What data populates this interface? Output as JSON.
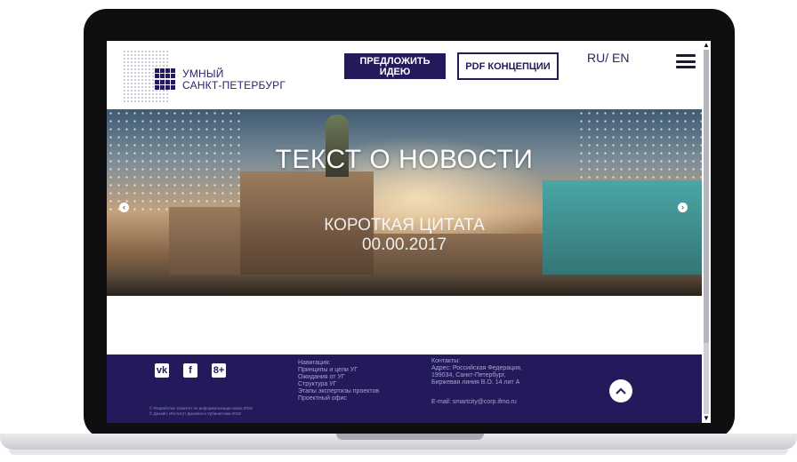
{
  "header": {
    "logo_line1": "УМНЫЙ",
    "logo_line2": "САНКТ-ПЕТЕРБУРГ",
    "idea_button_line1": "ПРЕДЛОЖИТЬ",
    "idea_button_line2": "ИДЕЮ",
    "pdf_button": "PDF КОНЦЕПЦИИ",
    "language_switch": "RU/ EN",
    "menu_icon": "hamburger-icon"
  },
  "hero": {
    "title": "ТЕКСТ О НОВОСТИ",
    "quote": "КОРОТКАЯ ЦИТАТА",
    "date": "00.00.2017",
    "prev_icon": "chevron-left-icon",
    "next_icon": "chevron-right-icon"
  },
  "footer": {
    "social": [
      "vk-icon",
      "facebook-icon",
      "google-plus-icon"
    ],
    "social_labels": [
      "vk",
      "f",
      "8+"
    ],
    "copyright_line1": "© Разработка: Комитет по информатизации связи 2018",
    "copyright_line2": "© Дизайн: Институт Дизайна и Урбанистики 2018",
    "nav_title": "Навигация:",
    "nav_items": [
      "Принципы и цели УГ",
      "Ожидания от УГ",
      "Структура УГ",
      "Этапы экспертизы проектов",
      "Проектный офис"
    ],
    "contacts_title": "Контакты:",
    "contacts_lines": [
      "Адрес: Российская Федерация,",
      "199034, Санкт-Петербург,",
      "Биржевая линия В.О. 14 лит А"
    ],
    "email": "E-mail: smartcity@corp.ifmo.ru",
    "scroll_top_icon": "arrow-up-icon"
  },
  "colors": {
    "brand": "#221a5a",
    "footer_text": "#a9a4d0"
  }
}
